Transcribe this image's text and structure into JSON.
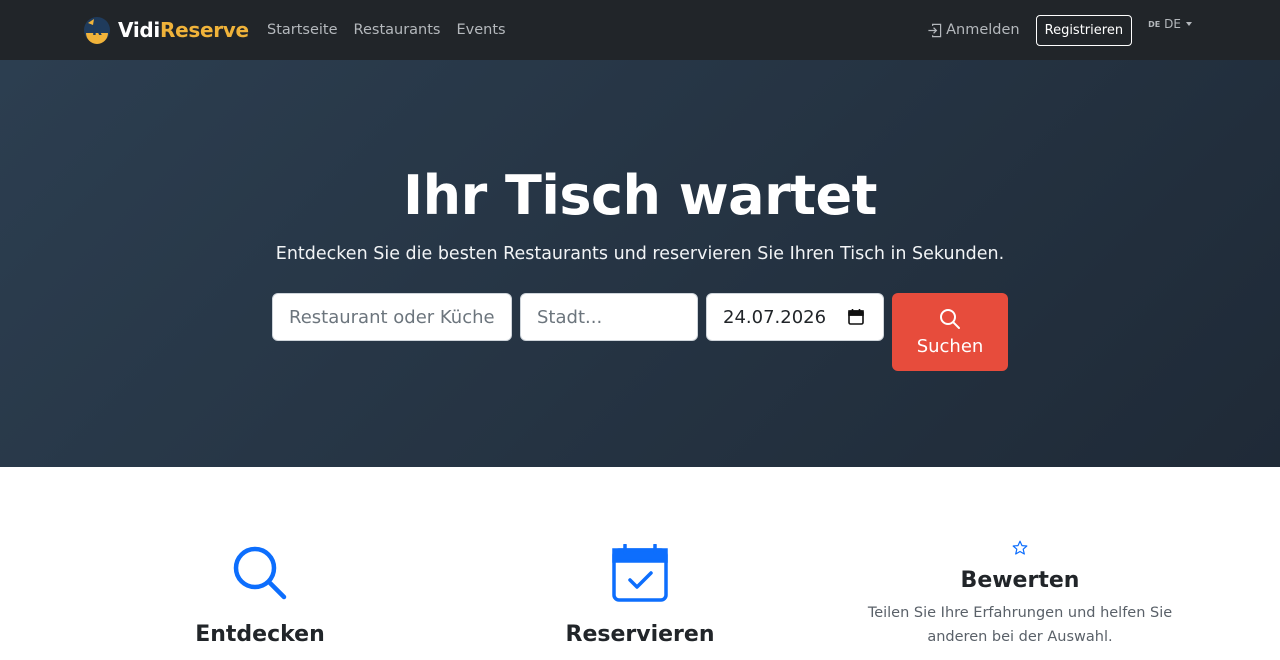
{
  "brand": {
    "name_part1": "Vidi",
    "name_part2": "Reserve",
    "logo_letter": "R"
  },
  "nav": {
    "items": [
      "Startseite",
      "Restaurants",
      "Events"
    ]
  },
  "auth": {
    "login": "Anmelden",
    "register": "Registrieren"
  },
  "language": {
    "flag": "DE",
    "label": "DE"
  },
  "hero": {
    "title": "Ihr Tisch wartet",
    "subtitle": "Entdecken Sie die besten Restaurants und reservieren Sie Ihren Tisch in Sekunden."
  },
  "search": {
    "query_placeholder": "Restaurant oder Küche...",
    "city_placeholder": "Stadt...",
    "date_value": "24.07.2026",
    "button_label": "Suchen"
  },
  "features": [
    {
      "icon": "search-icon",
      "title": "Entdecken"
    },
    {
      "icon": "calendar-check-icon",
      "title": "Reservieren"
    },
    {
      "icon": "star-icon",
      "title": "Bewerten",
      "text": "Teilen Sie Ihre Erfahrungen und helfen Sie anderen bei der Auswahl."
    }
  ],
  "colors": {
    "navbar": "#212529",
    "brand_accent": "#f0b33a",
    "hero_bg": "#2c3e50",
    "primary_button": "#e74c3c",
    "icon_blue": "#0d6efd"
  }
}
